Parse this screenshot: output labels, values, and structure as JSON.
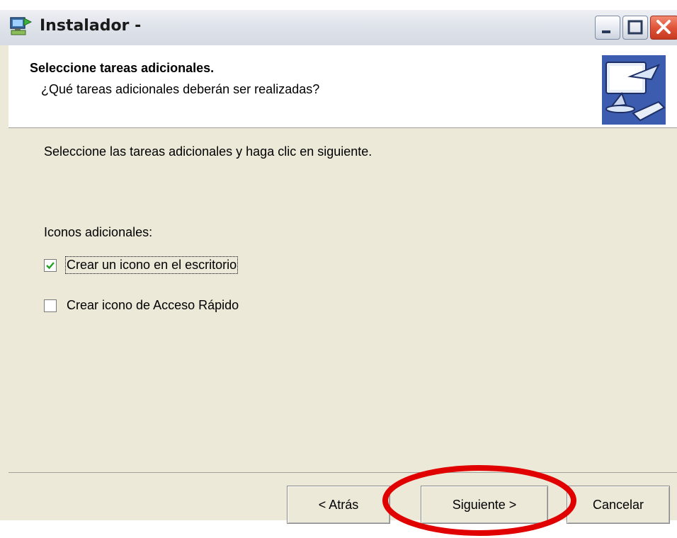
{
  "window": {
    "title": "Instalador -",
    "icons": {
      "app": "installer-computer-icon",
      "minimize": "minimize-icon",
      "maximize": "maximize-icon",
      "close": "close-icon",
      "header": "computer-install-icon"
    }
  },
  "header": {
    "title": "Seleccione tareas adicionales.",
    "subtitle": "¿Qué tareas adicionales deberán ser realizadas?"
  },
  "content": {
    "instruction": "Seleccione las tareas adicionales y haga clic en siguiente.",
    "section_label": "Iconos adicionales:",
    "options": [
      {
        "label": "Crear un icono en el escritorio",
        "checked": true,
        "focused": true
      },
      {
        "label": "Crear icono de Acceso Rápido",
        "checked": false,
        "focused": false
      }
    ]
  },
  "buttons": {
    "back": "< Atrás",
    "next": "Siguiente >",
    "cancel": "Cancelar"
  },
  "colors": {
    "window_bg": "#ece9d8",
    "highlight_ring": "#e00000",
    "close_button": "#e0553a"
  }
}
